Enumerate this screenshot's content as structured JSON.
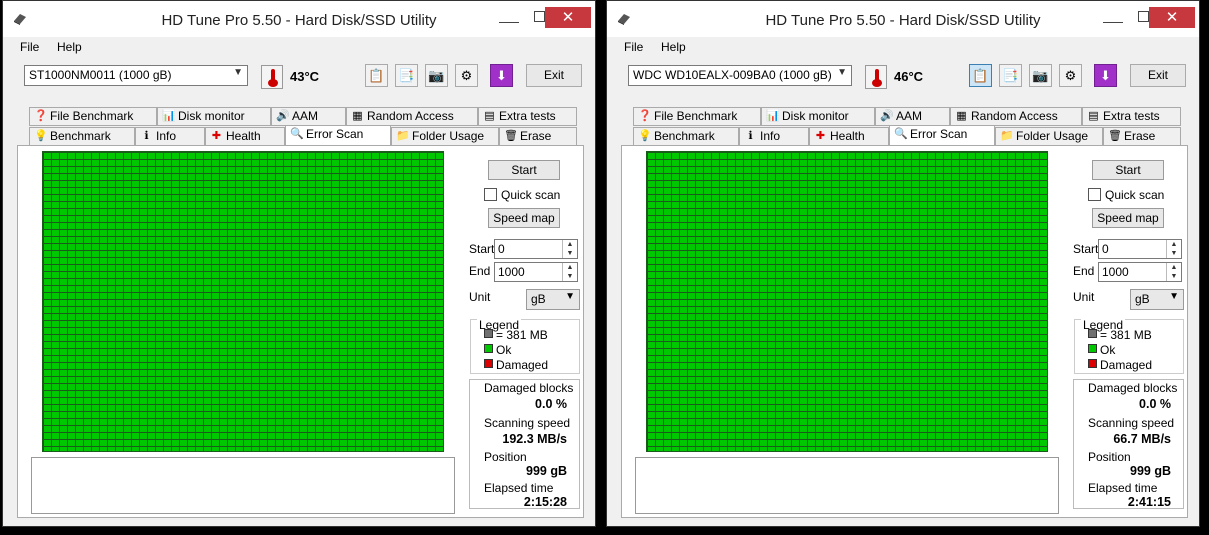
{
  "colors": {
    "ok": "#00c800",
    "block": "#707070",
    "damaged": "#dd0000",
    "close": "#c7383e"
  },
  "windows": [
    {
      "title": "HD Tune Pro 5.50 - Hard Disk/SSD Utility",
      "menu": {
        "file": "File",
        "help": "Help"
      },
      "toolbar": {
        "drive": "ST1000NM0011 (1000 gB)",
        "temp_value": "43",
        "temp_unit": "°C",
        "exit": "Exit"
      },
      "tabs_row1": [
        "File Benchmark",
        "Disk monitor",
        "AAM",
        "Random Access",
        "Extra tests"
      ],
      "tabs_row2": [
        "Benchmark",
        "Info",
        "Health",
        "Error Scan",
        "Folder Usage",
        "Erase"
      ],
      "active_tab": "Error Scan",
      "scan": {
        "start_button": "Start",
        "quick_scan": "Quick scan",
        "speed_map": "Speed map",
        "start_label": "Start",
        "start_value": "0",
        "end_label": "End",
        "end_value": "1000",
        "unit_label": "Unit",
        "unit_value": "gB"
      },
      "legend": {
        "title": "Legend",
        "block": "= 381 MB",
        "ok": "Ok",
        "damaged": "Damaged"
      },
      "stats": {
        "damaged_label": "Damaged blocks",
        "damaged_value": "0.0 %",
        "speed_label": "Scanning speed",
        "speed_value": "192.3 MB/s",
        "position_label": "Position",
        "position_value": "999 gB",
        "elapsed_label": "Elapsed time",
        "elapsed_value": "2:15:28"
      }
    },
    {
      "title": "HD Tune Pro 5.50 - Hard Disk/SSD Utility",
      "menu": {
        "file": "File",
        "help": "Help"
      },
      "toolbar": {
        "drive": "WDC WD10EALX-009BA0 (1000 gB)",
        "temp_value": "46",
        "temp_unit": "°C",
        "exit": "Exit"
      },
      "tabs_row1": [
        "File Benchmark",
        "Disk monitor",
        "AAM",
        "Random Access",
        "Extra tests"
      ],
      "tabs_row2": [
        "Benchmark",
        "Info",
        "Health",
        "Error Scan",
        "Folder Usage",
        "Erase"
      ],
      "active_tab": "Error Scan",
      "scan": {
        "start_button": "Start",
        "quick_scan": "Quick scan",
        "speed_map": "Speed map",
        "start_label": "Start",
        "start_value": "0",
        "end_label": "End",
        "end_value": "1000",
        "unit_label": "Unit",
        "unit_value": "gB"
      },
      "legend": {
        "title": "Legend",
        "block": "= 381 MB",
        "ok": "Ok",
        "damaged": "Damaged"
      },
      "stats": {
        "damaged_label": "Damaged blocks",
        "damaged_value": "0.0 %",
        "speed_label": "Scanning speed",
        "speed_value": "66.7 MB/s",
        "position_label": "Position",
        "position_value": "999 gB",
        "elapsed_label": "Elapsed time",
        "elapsed_value": "2:41:15"
      }
    }
  ]
}
